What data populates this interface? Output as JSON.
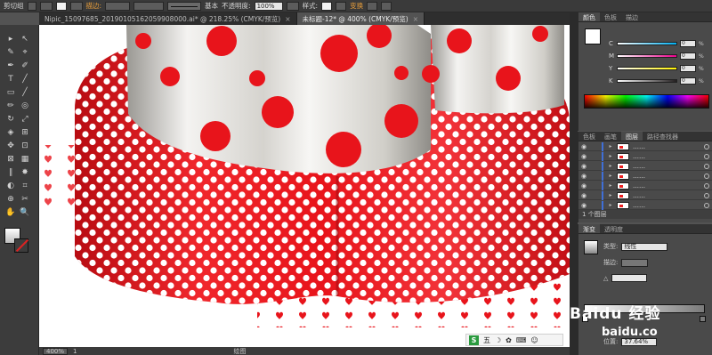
{
  "control_bar": {
    "crop_label": "剪切组",
    "stroke_label": "描边:",
    "brush_label": "基本",
    "opacity_label": "不透明度:",
    "opacity_value": "100%",
    "style_label": "样式:",
    "transform_label": "变换"
  },
  "tabs": [
    {
      "label": "Nipic_15097685_20190105162059908000.ai* @ 218.25% (CMYK/预览)",
      "close": "×",
      "active": false
    },
    {
      "label": "未标题-12* @ 400% (CMYK/预览)",
      "close": "×",
      "active": true
    }
  ],
  "tools": [
    "▸",
    "↖",
    "✎",
    "⌖",
    "✒",
    "✐",
    "T",
    "╱",
    "▭",
    "╱",
    "✏",
    "◎",
    "↻",
    "⤢",
    "◈",
    "⊞",
    "✥",
    "⊡",
    "⊠",
    "▦",
    "∥",
    "✸",
    "◐",
    "⌗",
    "⊕",
    "✂",
    "✋",
    "🔍"
  ],
  "status": {
    "zoom": "400%",
    "page": "1",
    "label": "绘图"
  },
  "ime": {
    "logo": "S",
    "items": [
      "五",
      "☽",
      "✿",
      "⌨",
      "☺"
    ]
  },
  "color_panel": {
    "tabs": [
      "颜色",
      "色板",
      "描边"
    ],
    "sliders": [
      {
        "letter": "C",
        "value": "0",
        "unit": "%",
        "color": "#00aeef"
      },
      {
        "letter": "M",
        "value": "0",
        "unit": "%",
        "color": "#ec008c"
      },
      {
        "letter": "Y",
        "value": "0",
        "unit": "%",
        "color": "#fff200"
      },
      {
        "letter": "K",
        "value": "0",
        "unit": "%",
        "color": "#231f20"
      }
    ]
  },
  "layers_panel": {
    "tabs": [
      "色板",
      "画笔",
      "图层",
      "路径查找器"
    ],
    "rows": [
      "……",
      "……",
      "……",
      "……",
      "……",
      "……",
      "……"
    ],
    "footer": "1 个图层"
  },
  "gradient_panel": {
    "tabs": [
      "渐变",
      "透明度"
    ],
    "type_label": "类型:",
    "type_value": "线性",
    "stroke_label": "描边:",
    "angle_label": "△",
    "position_label": "位置:",
    "position_value": "37.64%"
  },
  "watermark": {
    "main": "Baidu 经验",
    "sub": "baidu.co"
  },
  "colors": {
    "red": "#e8141b",
    "dot": "#ffffff",
    "ui_dark": "#3c3c3c",
    "accent": "#e59c3b"
  }
}
